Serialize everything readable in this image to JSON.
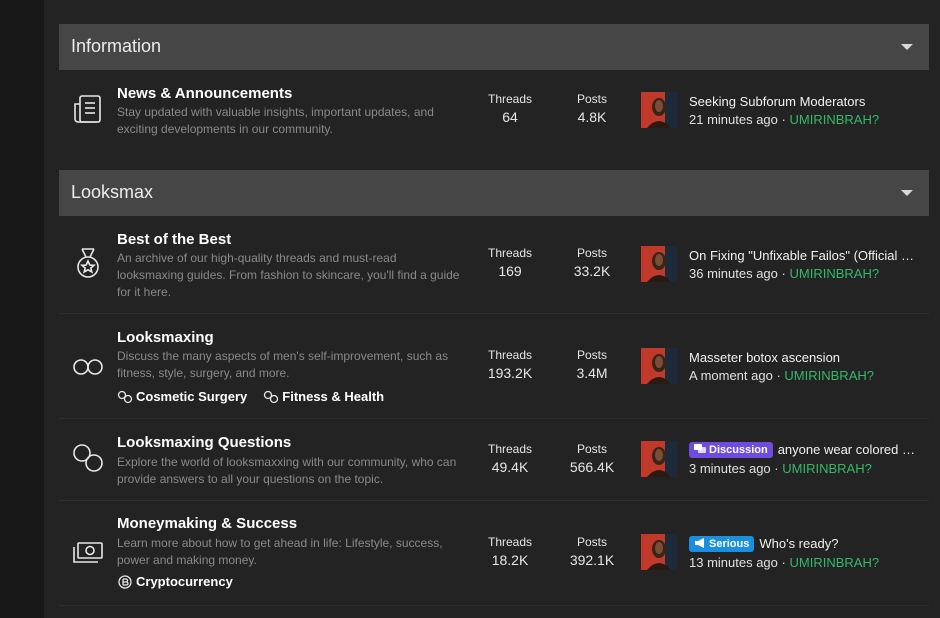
{
  "colors": {
    "accent_user": "#35b86a",
    "discussion_prefix": "#6e4ce0",
    "serious_prefix": "#1a8fe0",
    "category_bar": "#464646"
  },
  "categories": [
    {
      "title": "Information",
      "nodes": [
        {
          "icon": "newspaper-icon",
          "title": "News & Announcements",
          "description": "Stay updated with valuable insights, important updates, and exciting developments in our community.",
          "threads_label": "Threads",
          "threads": "64",
          "posts_label": "Posts",
          "posts": "4.8K",
          "latest": {
            "prefix": "",
            "title": "Seeking Subforum Moderators",
            "time": "21 minutes ago",
            "separator": "·",
            "user": "UMIRINBRAH?"
          }
        }
      ]
    },
    {
      "title": "Looksmax",
      "nodes": [
        {
          "icon": "medal-icon",
          "title": "Best of the Best",
          "description": "An archive of our high-quality threads and must-read looksmaxing guides. From fashion to skincare, you'll find a guide for it here.",
          "threads_label": "Threads",
          "threads": "169",
          "posts_label": "Posts",
          "posts": "33.2K",
          "latest": {
            "prefix": "",
            "title": "On Fixing \"Unfixable Failos\" (Official Guide)",
            "time": "36 minutes ago",
            "separator": "·",
            "user": "UMIRINBRAH?"
          }
        },
        {
          "icon": "infinity-icon",
          "title": "Looksmaxing",
          "description": "Discuss the many aspects of men's self-improvement, such as fitness, style, surgery, and more.",
          "subforums": [
            "Cosmetic Surgery",
            "Fitness & Health"
          ],
          "threads_label": "Threads",
          "threads": "193.2K",
          "posts_label": "Posts",
          "posts": "3.4M",
          "latest": {
            "prefix": "",
            "title": "Masseter botox ascension",
            "time": "A moment ago",
            "separator": "·",
            "user": "UMIRINBRAH?"
          }
        },
        {
          "icon": "bubbles-icon",
          "title": "Looksmaxing Questions",
          "description": "Explore the world of looksmaxxing with our community, who can provide answers to all your questions on the topic.",
          "threads_label": "Threads",
          "threads": "49.4K",
          "posts_label": "Posts",
          "posts": "566.4K",
          "latest": {
            "prefix": "Discussion",
            "title": "anyone wear colored contacts?",
            "time": "3 minutes ago",
            "separator": "·",
            "user": "UMIRINBRAH?"
          }
        },
        {
          "icon": "money-icon",
          "title": "Moneymaking & Success",
          "description": "Learn more about how to get ahead in life: Lifestyle, success, power and making money.",
          "subforums": [
            "Cryptocurrency"
          ],
          "threads_label": "Threads",
          "threads": "18.2K",
          "posts_label": "Posts",
          "posts": "392.1K",
          "latest": {
            "prefix": "Serious",
            "title": "Who's ready?",
            "time": "13 minutes ago",
            "separator": "·",
            "user": "UMIRINBRAH?"
          }
        }
      ]
    }
  ]
}
